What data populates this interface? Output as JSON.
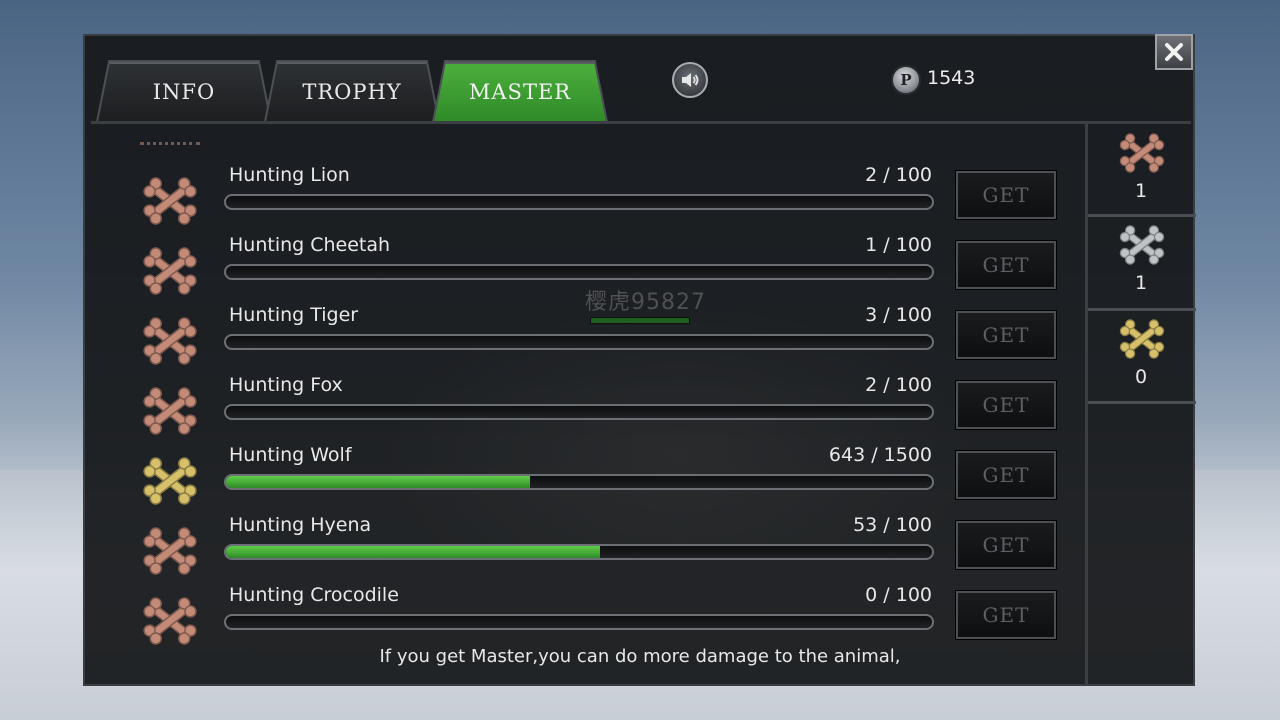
{
  "tabs": [
    {
      "label": "INFO",
      "active": false
    },
    {
      "label": "TROPHY",
      "active": false
    },
    {
      "label": "MASTER",
      "active": true
    }
  ],
  "header": {
    "sound_icon": "speaker-icon",
    "points_icon_letter": "P",
    "points": "1543",
    "close_icon": "close-icon"
  },
  "colors": {
    "active_tab": "#3f9f33",
    "bronze_bone": "#c48a78",
    "silver_bone": "#bfc3c7",
    "gold_bone": "#d6c06a"
  },
  "masteries": [
    {
      "label": "Hunting Lion",
      "progress": "2 / 100",
      "tier": "bronze",
      "button": "GET",
      "ratio": 0.02
    },
    {
      "label": "Hunting Cheetah",
      "progress": "1 / 100",
      "tier": "bronze",
      "button": "GET",
      "ratio": 0.01
    },
    {
      "label": "Hunting Tiger",
      "progress": "3 / 100",
      "tier": "bronze",
      "button": "GET",
      "ratio": 0.03
    },
    {
      "label": "Hunting Fox",
      "progress": "2 / 100",
      "tier": "bronze",
      "button": "GET",
      "ratio": 0.02
    },
    {
      "label": "Hunting Wolf",
      "progress": "643 / 1500",
      "tier": "gold",
      "button": "GET",
      "ratio": 0.43
    },
    {
      "label": "Hunting Hyena",
      "progress": "53 / 100",
      "tier": "bronze",
      "button": "GET",
      "ratio": 0.53
    },
    {
      "label": "Hunting Crocodile",
      "progress": "0 / 100",
      "tier": "bronze",
      "button": "GET",
      "ratio": 0.0
    }
  ],
  "summary": [
    {
      "tier": "bronze",
      "count": "1"
    },
    {
      "tier": "silver",
      "count": "1"
    },
    {
      "tier": "gold",
      "count": "0"
    }
  ],
  "background_player_name": "樱虎95827",
  "footer_text": "If you get Master,you can do more damage to the animal,"
}
